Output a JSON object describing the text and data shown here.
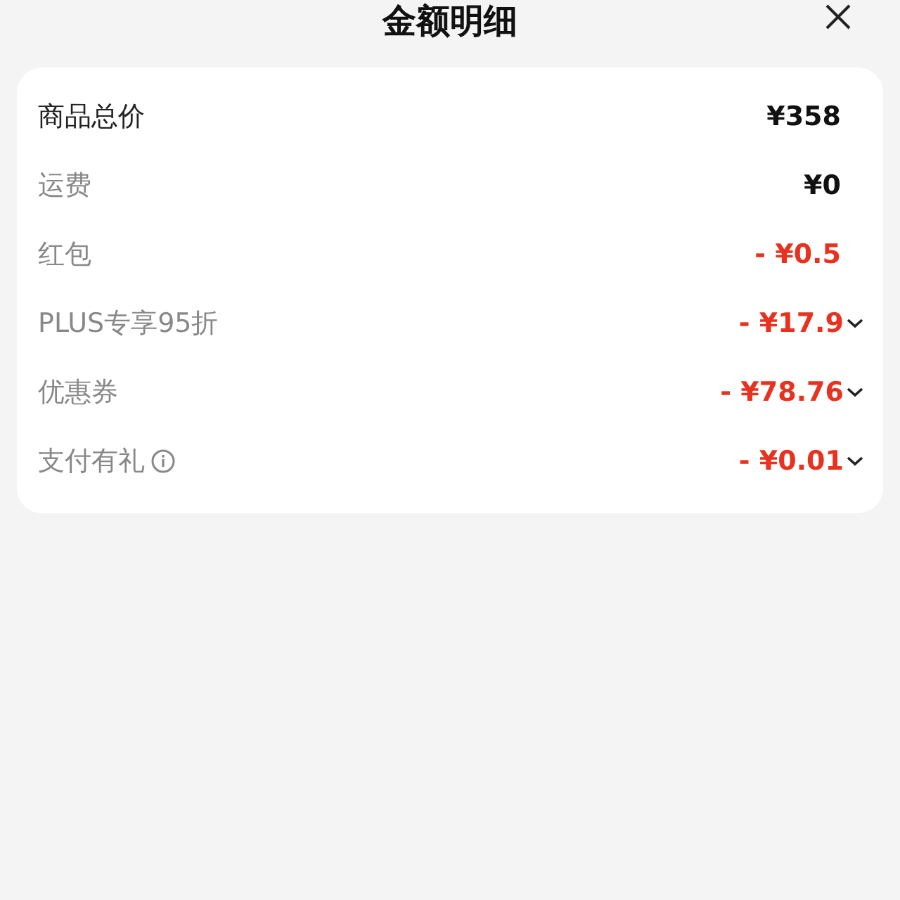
{
  "title": "金额明细",
  "rows": [
    {
      "label": "商品总价",
      "amount": "¥358",
      "kind": "total",
      "expandable": false,
      "info": false
    },
    {
      "label": "运费",
      "amount": "¥0",
      "kind": "fee",
      "expandable": false,
      "info": false
    },
    {
      "label": "红包",
      "amount": "- ¥0.5",
      "kind": "discount",
      "expandable": false,
      "info": false
    },
    {
      "label": "PLUS专享95折",
      "amount": "- ¥17.9",
      "kind": "discount",
      "expandable": true,
      "info": false
    },
    {
      "label": "优惠券",
      "amount": "- ¥78.76",
      "kind": "discount",
      "expandable": true,
      "info": false
    },
    {
      "label": "支付有礼",
      "amount": "- ¥0.01",
      "kind": "discount",
      "expandable": true,
      "info": true
    }
  ]
}
